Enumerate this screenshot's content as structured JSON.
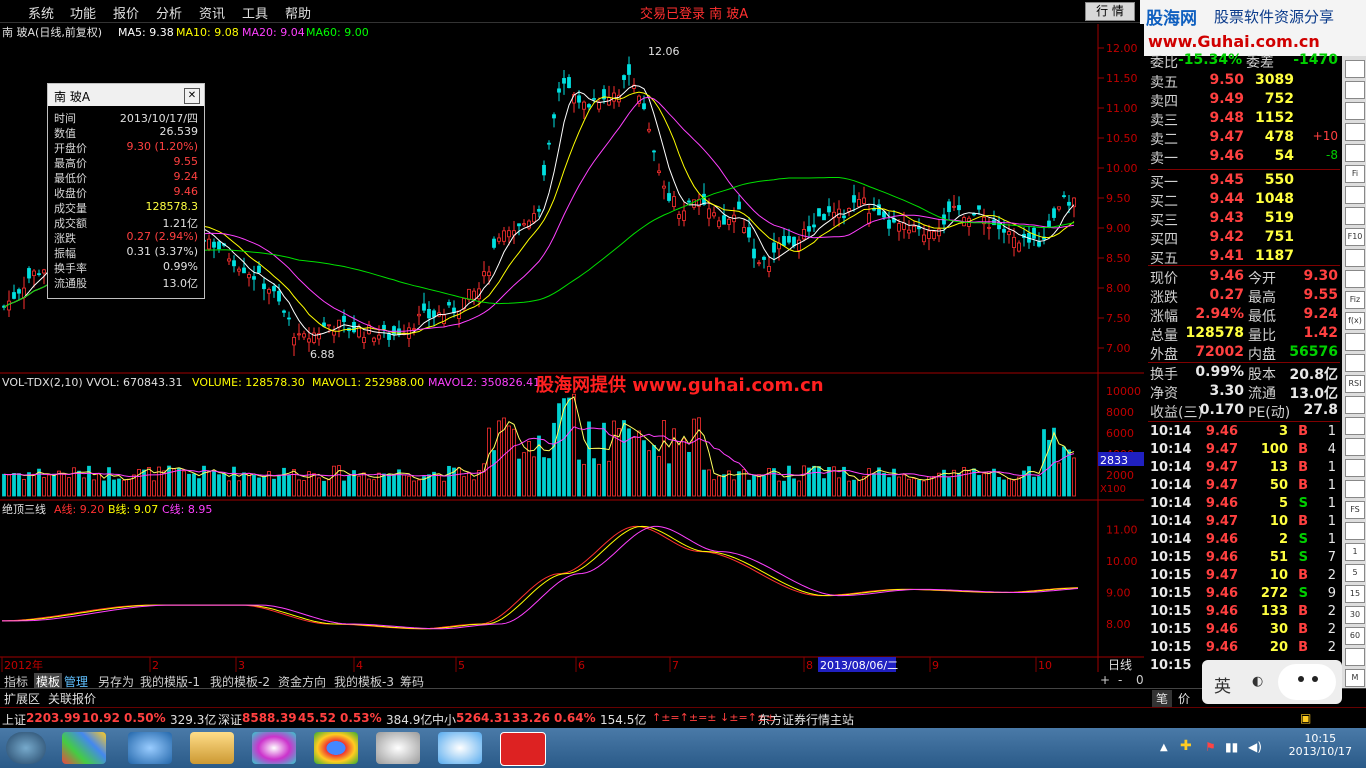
{
  "menu": [
    "系统",
    "功能",
    "报价",
    "分析",
    "资讯",
    "工具",
    "帮助"
  ],
  "status_center": "交易已登录   南 玻A",
  "quote_button": "行 情",
  "brand": {
    "name": "股海网",
    "slogan": "股票软件资源分享",
    "url": "www.Guhai.com.cn"
  },
  "chart": {
    "ma_legend": {
      "stock": "南 玻A(日线,前复权)",
      "ma5": "MA5: 9.38",
      "ma10": "MA10: 9.08",
      "ma20": "MA20: 9.04",
      "ma60": "MA60: 9.00"
    },
    "price_axis": [
      "12.00",
      "11.50",
      "11.00",
      "10.50",
      "10.00",
      "9.50",
      "9.00",
      "8.50",
      "8.00",
      "7.50",
      "7.00"
    ],
    "high_mark": "12.06",
    "low_mark": "6.88",
    "vol_legend": {
      "vwol": "VOL-TDX(2,10)  VVOL: 670843.31",
      "volume": "VOLUME: 128578.30",
      "mavol1": "MAVOL1: 252988.00",
      "mavol2": "MAVOL2: 350826.41"
    },
    "vol_axis": [
      "10000",
      "8000",
      "6000",
      "4000",
      "2000"
    ],
    "vol_current": "2833",
    "vol_unit": "X100",
    "watermark": "股海网提供  www.guhai.com.cn",
    "ind_legend": {
      "name": "绝顶三线",
      "a": "A线: 9.20",
      "b": "B线: 9.07",
      "c": "C线: 8.95"
    },
    "ind_axis": [
      "11.00",
      "10.00",
      "9.00",
      "8.00"
    ],
    "date_labels": [
      "2012年",
      "2",
      "3",
      "4",
      "5",
      "6",
      "7",
      "8",
      "9",
      "10"
    ],
    "date_cursor": "2013/08/06/二",
    "period": "日线"
  },
  "chart_data": {
    "type": "line",
    "title": "南 玻A(日线,前复权)",
    "x": [
      "2012-12",
      "2013-01",
      "2013-02",
      "2013-03",
      "2013-04",
      "2013-05",
      "2013-06",
      "2013-07",
      "2013-08",
      "2013-09",
      "2013-10"
    ],
    "series": [
      {
        "name": "MA5",
        "values": [
          7.7,
          8.7,
          8.3,
          7.4,
          7.3,
          8.2,
          11.1,
          9.8,
          8.7,
          9.2,
          9.38
        ]
      },
      {
        "name": "MA60",
        "values": [
          7.5,
          8.2,
          8.3,
          8.1,
          7.9,
          7.8,
          8.5,
          9.1,
          9.5,
          9.3,
          9.0
        ]
      }
    ],
    "ylim": [
      6.8,
      12.2
    ]
  },
  "info_popup": {
    "title": "南 玻A",
    "rows": [
      {
        "k": "时间",
        "v": "2013/10/17/四",
        "c": "white"
      },
      {
        "k": "数值",
        "v": "26.539",
        "c": "white"
      },
      {
        "k": "开盘价",
        "v": "9.30 (1.20%)",
        "c": "red"
      },
      {
        "k": "最高价",
        "v": "9.55",
        "c": "red"
      },
      {
        "k": "最低价",
        "v": "9.24",
        "c": "red"
      },
      {
        "k": "收盘价",
        "v": "9.46",
        "c": "red"
      },
      {
        "k": "成交量",
        "v": "128578.3",
        "c": "yellow"
      },
      {
        "k": "成交额",
        "v": "1.21亿",
        "c": "white"
      },
      {
        "k": "涨跌",
        "v": "0.27 (2.94%)",
        "c": "red"
      },
      {
        "k": "振幅",
        "v": "0.31 (3.37%)",
        "c": "white"
      },
      {
        "k": "换手率",
        "v": "0.99%",
        "c": "white"
      },
      {
        "k": "流通股",
        "v": "13.0亿",
        "c": "white"
      }
    ]
  },
  "order_book": {
    "header": {
      "l1": "委比",
      "v1": "-15.34%",
      "l2": "委差",
      "v2": "-1470"
    },
    "asks": [
      {
        "k": "卖五",
        "p": "9.50",
        "q": "3089",
        "d": ""
      },
      {
        "k": "卖四",
        "p": "9.49",
        "q": "752",
        "d": ""
      },
      {
        "k": "卖三",
        "p": "9.48",
        "q": "1152",
        "d": ""
      },
      {
        "k": "卖二",
        "p": "9.47",
        "q": "478",
        "d": "+10"
      },
      {
        "k": "卖一",
        "p": "9.46",
        "q": "54",
        "d": "-8"
      }
    ],
    "bids": [
      {
        "k": "买一",
        "p": "9.45",
        "q": "550"
      },
      {
        "k": "买二",
        "p": "9.44",
        "q": "1048"
      },
      {
        "k": "买三",
        "p": "9.43",
        "q": "519"
      },
      {
        "k": "买四",
        "p": "9.42",
        "q": "751"
      },
      {
        "k": "买五",
        "p": "9.41",
        "q": "1187"
      }
    ]
  },
  "stats": [
    {
      "k1": "现价",
      "v1": "9.46",
      "c1": "red",
      "k2": "今开",
      "v2": "9.30",
      "c2": "red"
    },
    {
      "k1": "涨跌",
      "v1": "0.27",
      "c1": "red",
      "k2": "最高",
      "v2": "9.55",
      "c2": "red"
    },
    {
      "k1": "涨幅",
      "v1": "2.94%",
      "c1": "red",
      "k2": "最低",
      "v2": "9.24",
      "c2": "red"
    },
    {
      "k1": "总量",
      "v1": "128578",
      "c1": "yellow",
      "k2": "量比",
      "v2": "1.42",
      "c2": "red"
    },
    {
      "k1": "外盘",
      "v1": "72002",
      "c1": "red",
      "k2": "内盘",
      "v2": "56576",
      "c2": "green"
    }
  ],
  "stats2": [
    {
      "k1": "换手",
      "v1": "0.99%",
      "k2": "股本",
      "v2": "20.8亿"
    },
    {
      "k1": "净资",
      "v1": "3.30",
      "k2": "流通",
      "v2": "13.0亿"
    },
    {
      "k1": "收益(三)",
      "v1": "0.170",
      "k2": "PE(动)",
      "v2": "27.8"
    }
  ],
  "ticks": [
    {
      "t": "10:14",
      "p": "9.46",
      "q": "3",
      "s": "B",
      "n": "1"
    },
    {
      "t": "10:14",
      "p": "9.47",
      "q": "100",
      "s": "B",
      "n": "4"
    },
    {
      "t": "10:14",
      "p": "9.47",
      "q": "13",
      "s": "B",
      "n": "1"
    },
    {
      "t": "10:14",
      "p": "9.47",
      "q": "50",
      "s": "B",
      "n": "1"
    },
    {
      "t": "10:14",
      "p": "9.46",
      "q": "5",
      "s": "S",
      "n": "1"
    },
    {
      "t": "10:14",
      "p": "9.47",
      "q": "10",
      "s": "B",
      "n": "1"
    },
    {
      "t": "10:14",
      "p": "9.46",
      "q": "2",
      "s": "S",
      "n": "1"
    },
    {
      "t": "10:15",
      "p": "9.46",
      "q": "51",
      "s": "S",
      "n": "7"
    },
    {
      "t": "10:15",
      "p": "9.47",
      "q": "10",
      "s": "B",
      "n": "2"
    },
    {
      "t": "10:15",
      "p": "9.46",
      "q": "272",
      "s": "S",
      "n": "9"
    },
    {
      "t": "10:15",
      "p": "9.46",
      "q": "133",
      "s": "B",
      "n": "2"
    },
    {
      "t": "10:15",
      "p": "9.46",
      "q": "30",
      "s": "B",
      "n": "2"
    },
    {
      "t": "10:15",
      "p": "9.46",
      "q": "20",
      "s": "B",
      "n": "2"
    },
    {
      "t": "10:15",
      "p": "",
      "q": "",
      "s": "",
      "n": ""
    }
  ],
  "tabs": [
    "指标",
    "模板",
    "管理",
    "另存为",
    "我的模版-1",
    "我的模板-2",
    "资金方向",
    "我的模板-3",
    "筹码"
  ],
  "tabs_right": [
    "+",
    "-",
    "0"
  ],
  "ext_bar": [
    "扩展区",
    "关联报价"
  ],
  "right_tabs": [
    "笔",
    "价"
  ],
  "index_bar": [
    {
      "name": "上证",
      "value": "2203.99",
      "chg": "10.92",
      "pct": "0.50%",
      "amt": "329.3亿"
    },
    {
      "name": "深证",
      "value": "8588.39",
      "chg": "45.52",
      "pct": "0.53%",
      "amt": "384.9亿"
    },
    {
      "name": "中小",
      "value": "5264.31",
      "chg": "33.26",
      "pct": "0.64%",
      "amt": "154.5亿"
    }
  ],
  "index_signals": "↑±=↑±=±  ↓±=↑±±",
  "index_extra": "东方证券行情主站",
  "ime": "英",
  "clock": {
    "time": "10:15",
    "date": "2013/10/17"
  },
  "side_tools": [
    "",
    "",
    "",
    "",
    "",
    "Fi",
    "",
    "",
    "F10",
    "",
    "",
    "Fiz",
    "f(x)",
    "",
    "",
    "RSI",
    "",
    "",
    "",
    "",
    "",
    "FS",
    "",
    "1",
    "5",
    "15",
    "30",
    "60",
    "",
    "M"
  ]
}
